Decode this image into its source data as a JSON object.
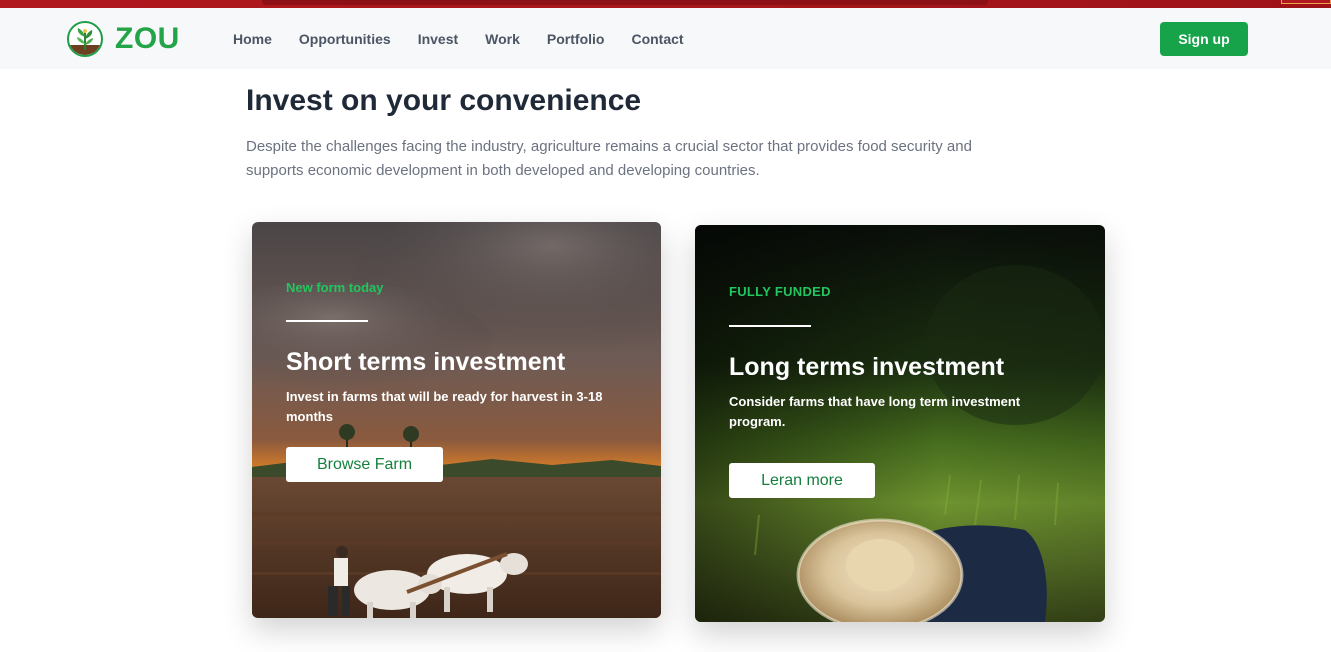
{
  "brand": {
    "name": "ZOU"
  },
  "nav": {
    "links": [
      "Home",
      "Opportunities",
      "Invest",
      "Work",
      "Portfolio",
      "Contact"
    ],
    "signup_label": "Sign up"
  },
  "hero": {
    "title": "Invest on your convenience",
    "description": "Despite the challenges facing the industry, agriculture remains a crucial sector that provides food security and supports economic development in both developed and developing countries."
  },
  "cards": [
    {
      "eyebrow": "New form today",
      "title": "Short terms investment",
      "description": "Invest in farms that will be ready for harvest in 3-18 months",
      "button": "Browse Farm"
    },
    {
      "eyebrow": "FULLY FUNDED",
      "title": "Long terms investment",
      "description": "Consider farms that have long term investment program.",
      "button": "Leran more"
    }
  ],
  "colors": {
    "brand_green": "#16a34a",
    "top_strip": "#b0191e"
  }
}
